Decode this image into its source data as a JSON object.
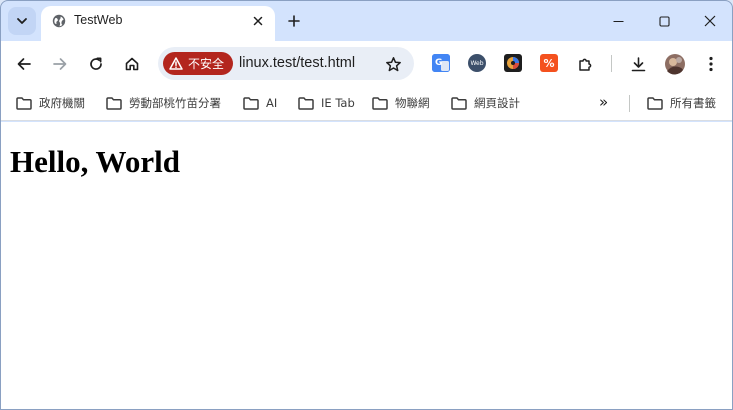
{
  "tab": {
    "title": "TestWeb"
  },
  "omnibox": {
    "security_label": "不安全",
    "url": "linux.test/test.html"
  },
  "bookmarks": {
    "items": [
      {
        "label": "政府機關"
      },
      {
        "label": "勞動部桃竹苗分署"
      },
      {
        "label": "AI"
      },
      {
        "label": "IE Tab"
      },
      {
        "label": "物聯網"
      },
      {
        "label": "網頁設計"
      }
    ],
    "overflow_label": "»",
    "all_bookmarks_label": "所有書籤"
  },
  "extensions": [
    {
      "name": "google-translate-icon",
      "color": "#4285f4"
    },
    {
      "name": "web-extension-icon",
      "color": "#3c4f6a",
      "text": "Web"
    },
    {
      "name": "color-picker-extension-icon",
      "color": "#1e1e1e"
    },
    {
      "name": "percent-extension-icon",
      "color": "#f4511e",
      "text": "%"
    }
  ],
  "page": {
    "heading": "Hello, World"
  },
  "colors": {
    "accent": "#d3e3fd",
    "danger": "#b3261e",
    "toolbar": "#ffffff"
  }
}
